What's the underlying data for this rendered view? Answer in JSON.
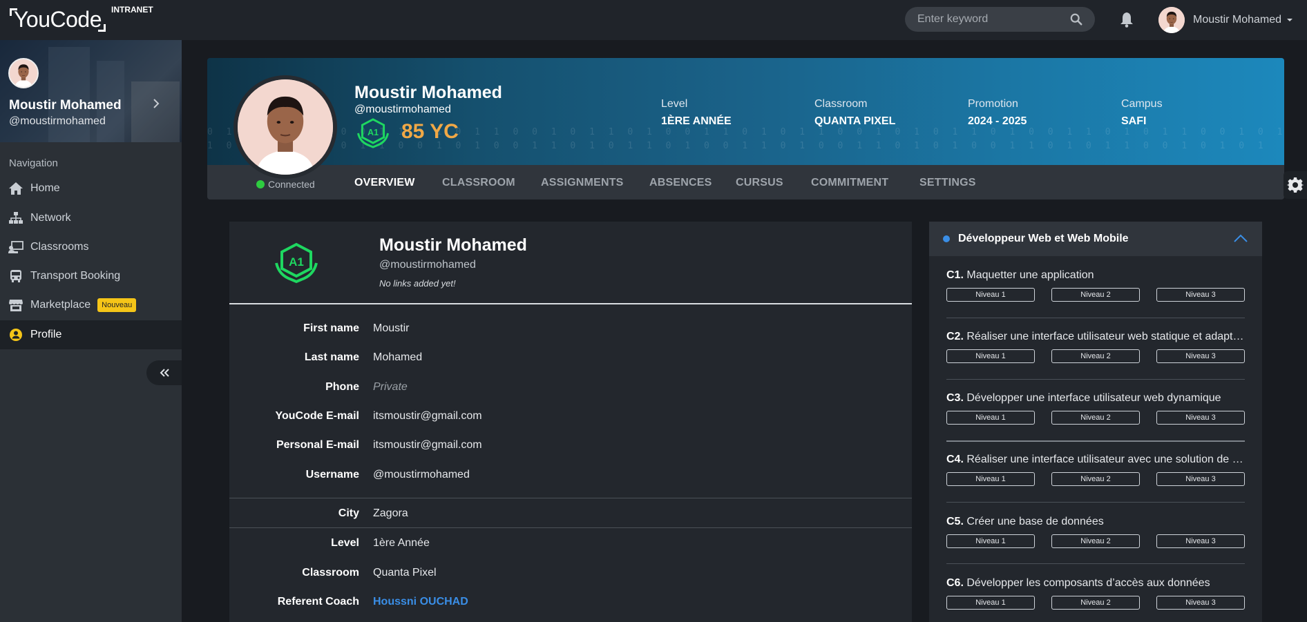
{
  "topbar": {
    "logo": "YouCode",
    "logo_sub": "INTRANET",
    "search_placeholder": "Enter keyword",
    "user_name": "Moustir Mohamed"
  },
  "sidebar": {
    "name": "Moustir Mohamed",
    "handle": "@moustirmohamed",
    "nav_label": "Navigation",
    "items": [
      {
        "label": "Home",
        "icon": "home-icon"
      },
      {
        "label": "Network",
        "icon": "network-icon"
      },
      {
        "label": "Classrooms",
        "icon": "classroom-icon"
      },
      {
        "label": "Transport Booking",
        "icon": "bus-icon"
      },
      {
        "label": "Marketplace",
        "icon": "store-icon",
        "badge": "Nouveau"
      },
      {
        "label": "Profile",
        "icon": "user-circle-icon",
        "active": true
      }
    ]
  },
  "banner": {
    "name": "Moustir Mohamed",
    "handle": "@moustirmohamed",
    "yc": "85 YC",
    "status": "Connected",
    "stats": [
      {
        "key": "Level",
        "value": "1ÈRE ANNÉE"
      },
      {
        "key": "Classroom",
        "value": "QUANTA PIXEL"
      },
      {
        "key": "Promotion",
        "value": "2024 - 2025"
      },
      {
        "key": "Campus",
        "value": "SAFI"
      }
    ],
    "tabs": [
      "OVERVIEW",
      "CLASSROOM",
      "ASSIGNMENTS",
      "ABSENCES",
      "CURSUS",
      "COMMITMENT",
      "SETTINGS"
    ],
    "active_tab": "OVERVIEW"
  },
  "card": {
    "name": "Moustir Mohamed",
    "handle": "@moustirmohamed",
    "no_links": "No links added yet!",
    "fields": [
      {
        "label": "First name",
        "value": "Moustir"
      },
      {
        "label": "Last name",
        "value": "Mohamed"
      },
      {
        "label": "Phone",
        "value": "Private"
      },
      {
        "label": "YouCode E-mail",
        "value": "itsmoustir@gmail.com"
      },
      {
        "label": "Personal E-mail",
        "value": "itsmoustir@gmail.com"
      },
      {
        "label": "Username",
        "value": "@moustirmohamed"
      },
      {
        "label": "City",
        "value": "Zagora"
      },
      {
        "label": "Level",
        "value": "1ère Année"
      },
      {
        "label": "Classroom",
        "value": "Quanta Pixel"
      },
      {
        "label": "Referent Coach",
        "value": "Houssni OUCHAD"
      }
    ]
  },
  "competencies": {
    "title": "Développeur Web et Web Mobile",
    "levels": [
      "Niveau 1",
      "Niveau 2",
      "Niveau 3"
    ],
    "items": [
      {
        "code": "C1.",
        "text": "Maquetter une application"
      },
      {
        "code": "C2.",
        "text": "Réaliser une interface utilisateur web statique et adapta..."
      },
      {
        "code": "C3.",
        "text": "Développer une interface utilisateur web dynamique"
      },
      {
        "code": "C4.",
        "text": "Réaliser une interface utilisateur avec une solution de g..."
      },
      {
        "code": "C5.",
        "text": "Créer une base de données"
      },
      {
        "code": "C6.",
        "text": "Développer les composants d’accès aux données"
      }
    ]
  },
  "colors": {
    "accent": "#3a8ee6",
    "yc": "#f0a846",
    "badge": "#f5c518",
    "green": "#2ecc40"
  }
}
